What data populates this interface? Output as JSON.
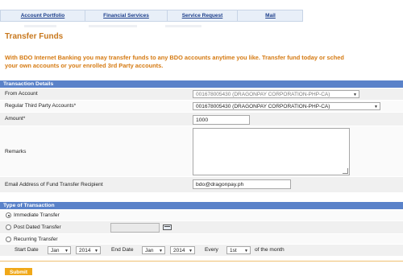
{
  "nav": {
    "tabs": [
      {
        "label": "Account Portfolio"
      },
      {
        "label": "Financial Services"
      },
      {
        "label": "Service Request"
      },
      {
        "label": "Mail"
      }
    ]
  },
  "page": {
    "title": "Transfer Funds",
    "intro_line1": "With BDO Internet Banking you may transfer funds to any BDO accounts anytime you like. Transfer fund today or sched",
    "intro_line2": "your own accounts or your enrolled 3rd Party accounts."
  },
  "transaction_details": {
    "header": "Transaction Details",
    "from_account": {
      "label": "From Account",
      "value": "001678005430 (DRAGONPAY CORPORATION-PHP-CA)"
    },
    "third_party": {
      "label": "Regular Third Party Accounts*",
      "value": "001678005430 (DRAGONPAY CORPORATION-PHP-CA)"
    },
    "amount": {
      "label": "Amount*",
      "value": "1000"
    },
    "remarks": {
      "label": "Remarks",
      "value": ""
    },
    "email": {
      "label": "Email Address of Fund Transfer Recipient",
      "value": "bdo@dragonpay.ph"
    }
  },
  "type_of_transaction": {
    "header": "Type of Transaction",
    "immediate": {
      "label": "Immediate Transfer",
      "selected": true
    },
    "post_dated": {
      "label": "Post Dated Transfer",
      "selected": false
    },
    "recurring": {
      "label": "Recurring Transfer",
      "selected": false
    },
    "start_date_label": "Start Date",
    "start_month": "Jan",
    "start_year": "2014",
    "end_date_label": "End Date",
    "end_month": "Jan",
    "end_year": "2014",
    "every_label": "Every",
    "every_value": "1st",
    "of_month_label": "of the month"
  },
  "actions": {
    "submit_label": "Submit"
  },
  "colors": {
    "accent": "#d57a12",
    "section": "#5a82c9",
    "nav_text": "#1a3d8a",
    "submit": "#f0a818"
  }
}
